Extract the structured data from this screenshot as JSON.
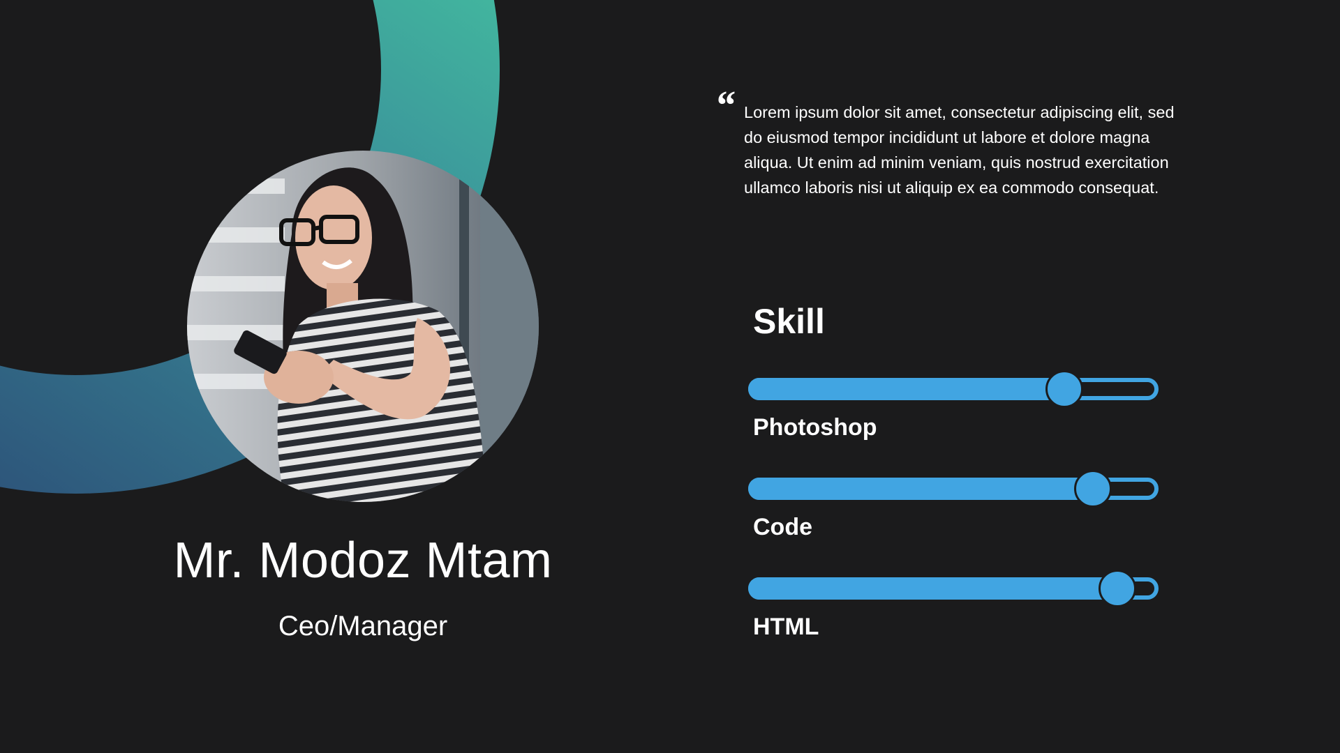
{
  "profile": {
    "name": "Mr. Modoz Mtam",
    "role": "Ceo/Manager"
  },
  "quote": {
    "mark": "“",
    "text": "Lorem ipsum dolor sit amet, consectetur adipiscing elit, sed do eiusmod tempor incididunt ut labore et dolore magna aliqua. Ut enim ad minim veniam, quis nostrud exercitation ullamco laboris nisi ut aliquip ex ea commodo consequat."
  },
  "skills": {
    "title": "Skill",
    "items": [
      {
        "label": "Photoshop",
        "level": 0.77
      },
      {
        "label": "Code",
        "level": 0.84
      },
      {
        "label": "HTML",
        "level": 0.9
      }
    ]
  },
  "colors": {
    "background": "#1b1b1c",
    "accent_blue": "#41a5e2",
    "ring_green": "#46c9a0",
    "ring_navy": "#2c4f77"
  },
  "icons": {
    "quote": "quote-icon"
  }
}
